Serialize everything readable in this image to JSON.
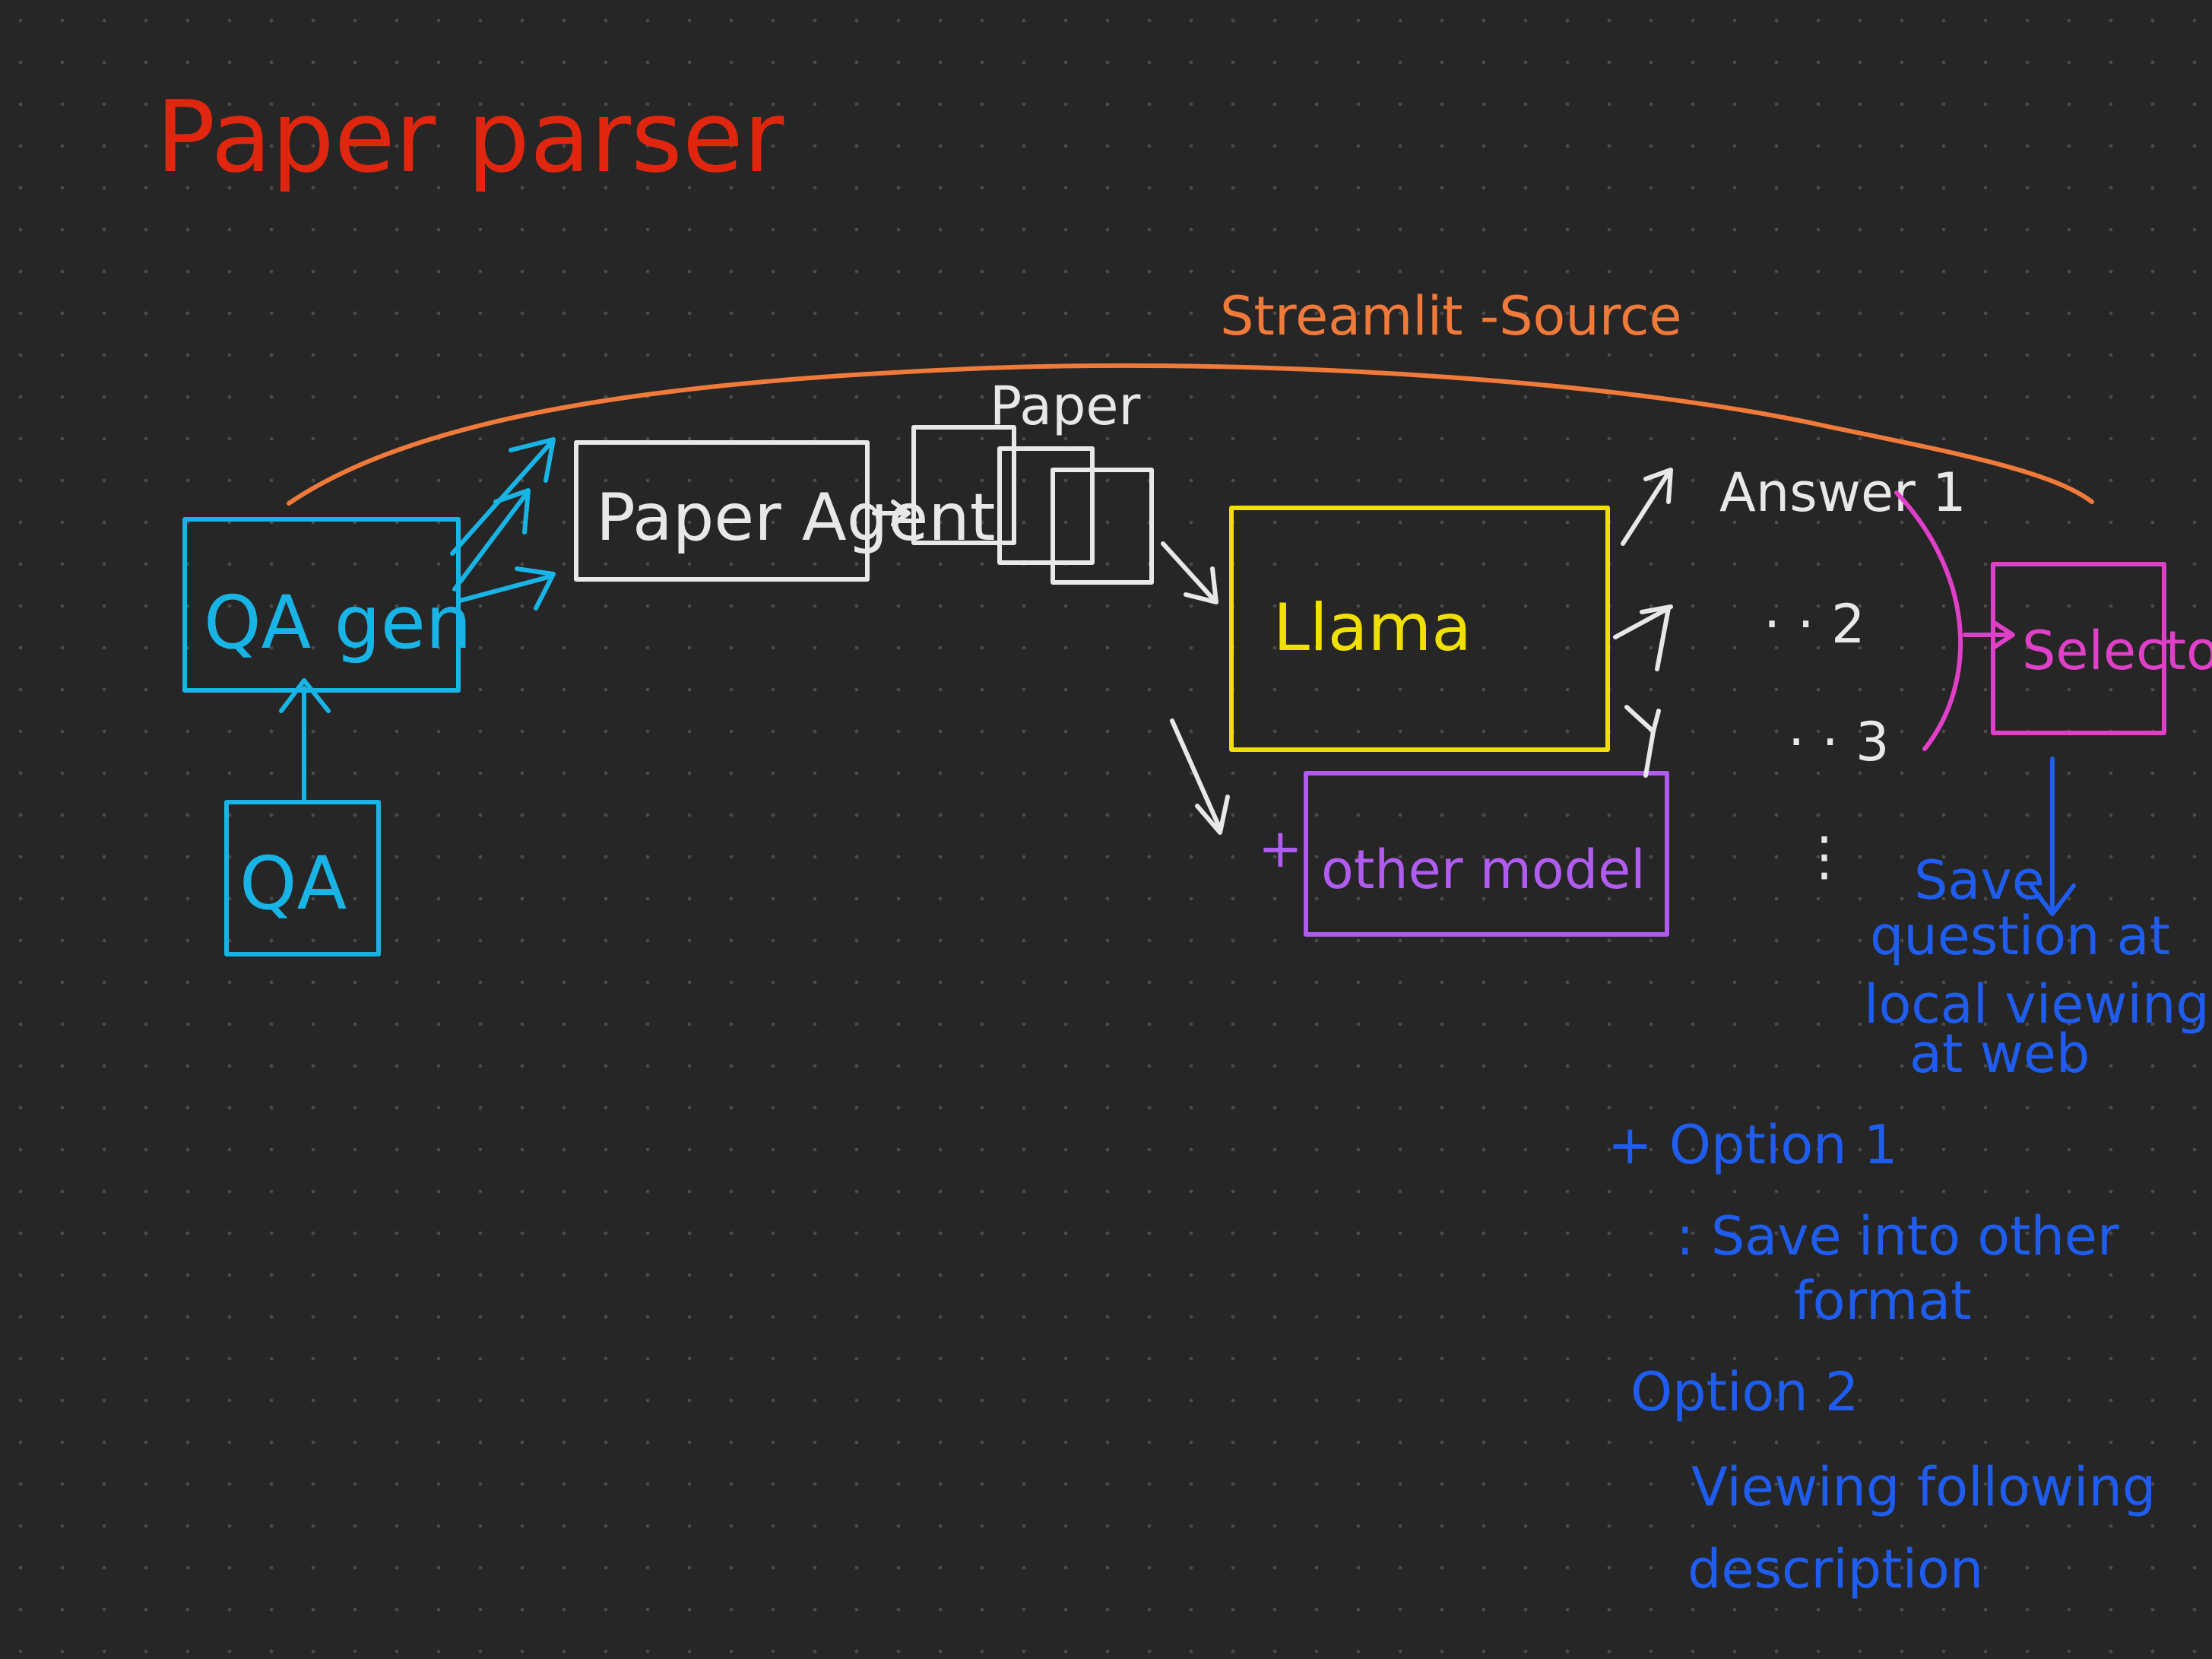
{
  "colors": {
    "background": "#262626",
    "grid_dot": "#4a4a4a",
    "title": "#e0260f",
    "streamlit": "#f07a3a",
    "qa": "#19b4e6",
    "white": "#e8e8e8",
    "llama": "#f0e000",
    "other_model": "#b05cf0",
    "selector": "#e040c8",
    "notes": "#1f5df0"
  },
  "title": "Paper parser",
  "streamlit_label": "Streamlit -Source",
  "qa_gen_label": "QA gen",
  "qa_label": "QA",
  "paper_agent_label": "Paper Agent",
  "paper_label": "Paper",
  "llama_label": "Llama",
  "other_model_plus": "+",
  "other_model_label": "other model",
  "answers": {
    "a1": "Answer 1",
    "a2": "· · 2",
    "a3": "· · 3",
    "dots": "⋮"
  },
  "selector_label": "Selector",
  "save_note": {
    "l1": "Save",
    "l2": "question at",
    "l3": "local viewing",
    "l4": "at web"
  },
  "option1": {
    "l1": "+ Option 1",
    "l2": ": Save into other",
    "l3": "format"
  },
  "option2": {
    "l1": "Option 2",
    "l2": "Viewing following",
    "l3": "description"
  }
}
